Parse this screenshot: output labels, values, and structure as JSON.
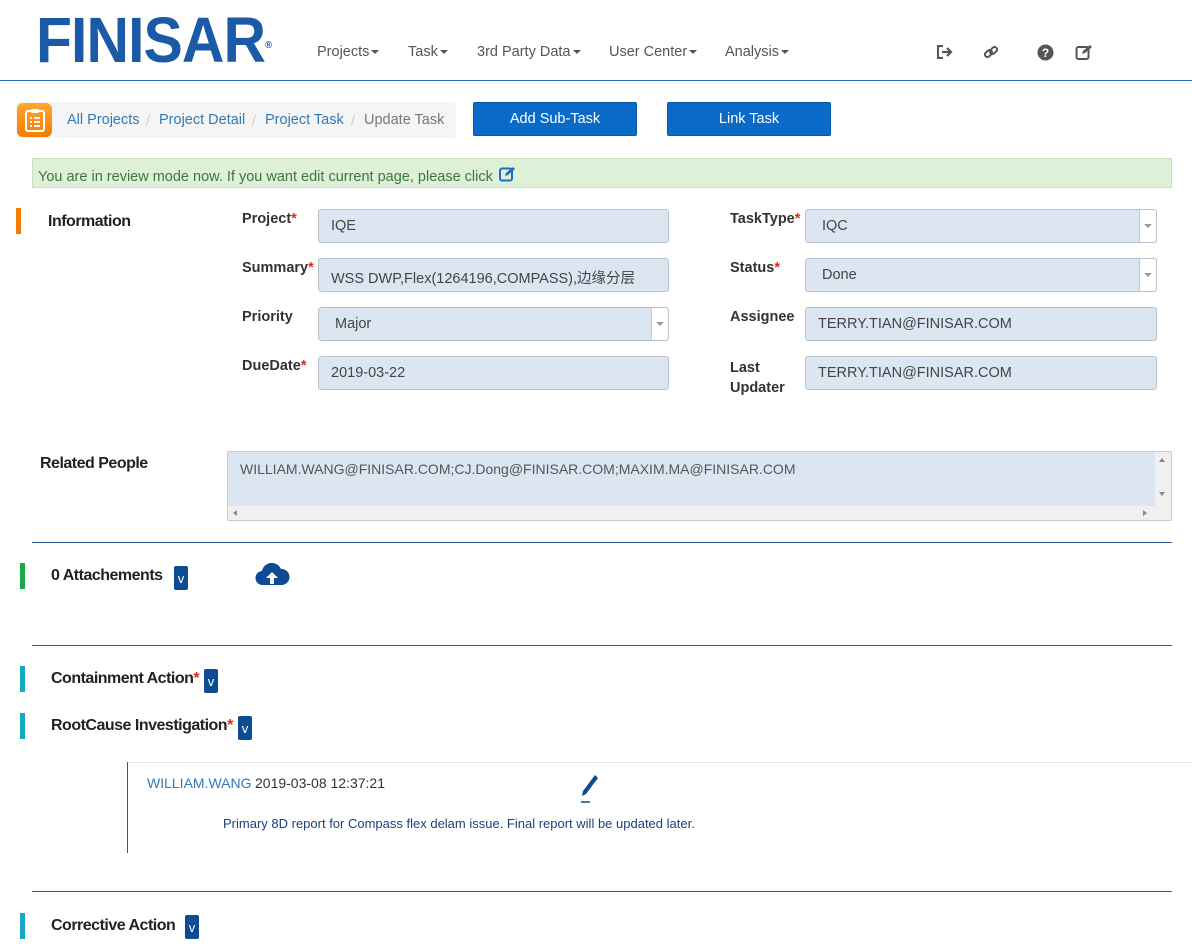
{
  "header": {
    "logo": "FINISAR",
    "logo_mark": "®",
    "nav": [
      "Projects",
      "Task",
      "3rd Party Data",
      "User Center",
      "Analysis"
    ]
  },
  "icons": {
    "logout": "sign-out-icon",
    "link": "link-icon",
    "help": "question-circle-icon",
    "edit": "edit-icon"
  },
  "breadcrumb": {
    "items": [
      "All Projects",
      "Project Detail",
      "Project Task"
    ],
    "current": "Update Task",
    "separator": "/"
  },
  "buttons": {
    "add_subtask": "Add Sub-Task",
    "link_task": "Link Task"
  },
  "alert": {
    "text": "You are in review mode now. If you want edit current page, please click"
  },
  "information": {
    "title": "Information",
    "project_label": "Project",
    "project_value": "IQE",
    "summary_label": "Summary",
    "summary_value": "WSS DWP,Flex(1264196,COMPASS),边缘分层",
    "priority_label": "Priority",
    "priority_value": "Major",
    "duedate_label": "DueDate",
    "duedate_value": "2019-03-22",
    "tasktype_label": "TaskType",
    "tasktype_value": "IQC",
    "status_label": "Status",
    "status_value": "Done",
    "assignee_label": "Assignee",
    "assignee_value": "TERRY.TIAN@FINISAR.COM",
    "lastupdater_label_1": "Last",
    "lastupdater_label_2": "Updater",
    "lastupdater_value": "TERRY.TIAN@FINISAR.COM",
    "required_mark": "*"
  },
  "related_people": {
    "label": "Related People",
    "value": "WILLIAM.WANG@FINISAR.COM;CJ.Dong@FINISAR.COM;MAXIM.MA@FINISAR.COM"
  },
  "attachments": {
    "title": "0 Attachements",
    "toggle": "v"
  },
  "containment": {
    "title": "Containment Action",
    "toggle": "v"
  },
  "rootcause": {
    "title": "RootCause Investigation",
    "toggle": "v",
    "comment": {
      "author": "WILLIAM.WANG",
      "time": "2019-03-08 12:37:21",
      "text": "Primary 8D report for Compass flex delam issue.  Final report will be updated later."
    }
  },
  "corrective": {
    "title": "Corrective Action",
    "toggle": "v"
  },
  "colors": {
    "brand": "#1a5aa6",
    "button": "#0a6ac7",
    "marker_info": "#f57c00",
    "marker_attach": "#1aaa4a",
    "marker_action": "#17a8c4",
    "alert_bg": "#dff0d8",
    "field_bg": "#dce6f2"
  }
}
